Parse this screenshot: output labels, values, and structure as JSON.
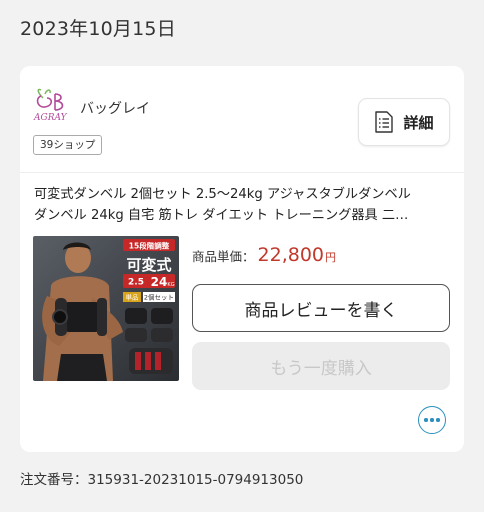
{
  "order_date": "2023年10月15日",
  "shop": {
    "name": "バッグレイ",
    "logo_text": "AGRAY",
    "tag": "39ショップ"
  },
  "detail_button": {
    "label": "詳細",
    "icon": "document-icon"
  },
  "product": {
    "title_line1": "可変式ダンベル 2個セット 2.5〜24kg アジャスタブルダンベル",
    "title_line2": "ダンベル 24kg 自宅 筋トレ ダイエット トレーニング器具 二…",
    "image_text": {
      "badge": "15段階調整",
      "main": "可変式",
      "range_low": "2.5",
      "range_high": "24",
      "unit": "KG",
      "single": "単品",
      "pair": "2個セット"
    },
    "price_label": "商品単価：",
    "price_value": "22,800",
    "price_unit": "円"
  },
  "review_button": {
    "label": "商品レビューを書く"
  },
  "rebuy_button": {
    "label": "もう一度購入"
  },
  "more_button": {
    "icon": "more-horizontal-icon"
  },
  "order_number": "注文番号：315931-20231015-0794913050",
  "colors": {
    "accent_blue": "#2a8fbd",
    "price_red": "#c0392b",
    "background": "#f2f2f2"
  }
}
